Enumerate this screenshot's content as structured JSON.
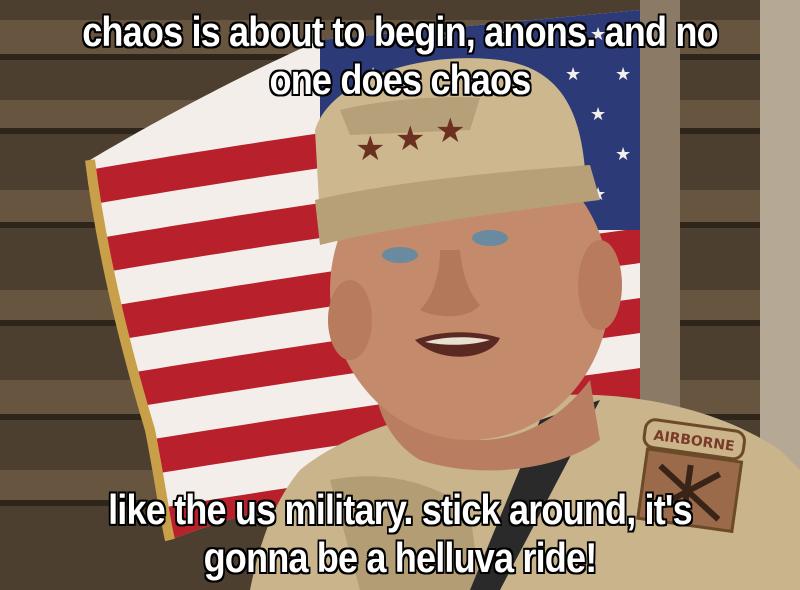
{
  "meme": {
    "top_text": "chaos is about to begin, anons. and no one does chaos",
    "bottom_text": "like the us military. stick around, it's gonna be a helluva ride!"
  },
  "patch": {
    "tab_text": "AIRBORNE"
  },
  "colors": {
    "flag_red": "#b8202c",
    "flag_white": "#f4eeea",
    "flag_blue": "#2c3a78",
    "uniform_tan": "#c9b48c",
    "wood_brown": "#5a4a36",
    "caption_fill": "#ffffff",
    "caption_outline": "#000000"
  }
}
